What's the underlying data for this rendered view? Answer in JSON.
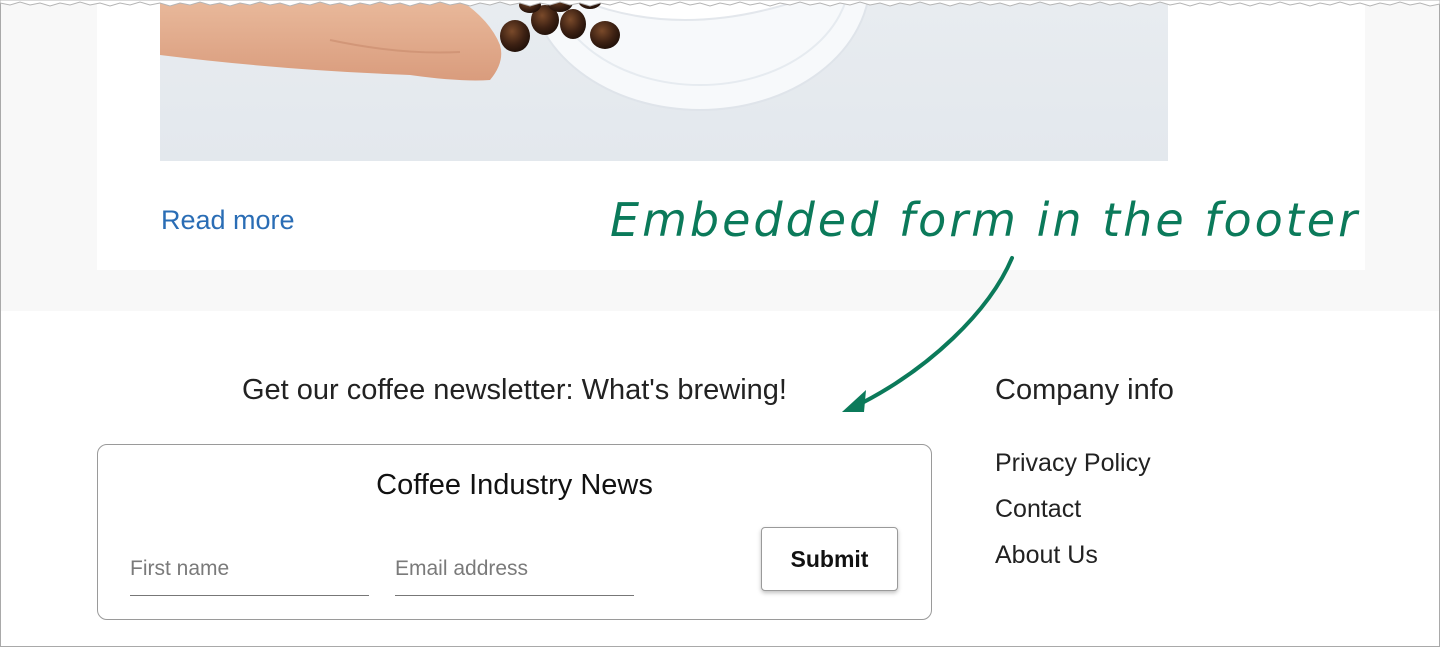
{
  "post": {
    "read_more": "Read more"
  },
  "annotation": {
    "text": "Embedded form in the footer",
    "color": "#0b7a5a"
  },
  "newsletter": {
    "heading": "Get our coffee newsletter: What's brewing!",
    "form_title": "Coffee Industry News",
    "first_name_placeholder": "First name",
    "email_placeholder": "Email address",
    "submit_label": "Submit"
  },
  "company": {
    "heading": "Company info",
    "links": [
      "Privacy Policy",
      "Contact",
      "About Us"
    ]
  },
  "colors": {
    "link_blue": "#2a6db5",
    "upper_background": "#f8f8f8",
    "border_gray": "#9a9a9a"
  }
}
